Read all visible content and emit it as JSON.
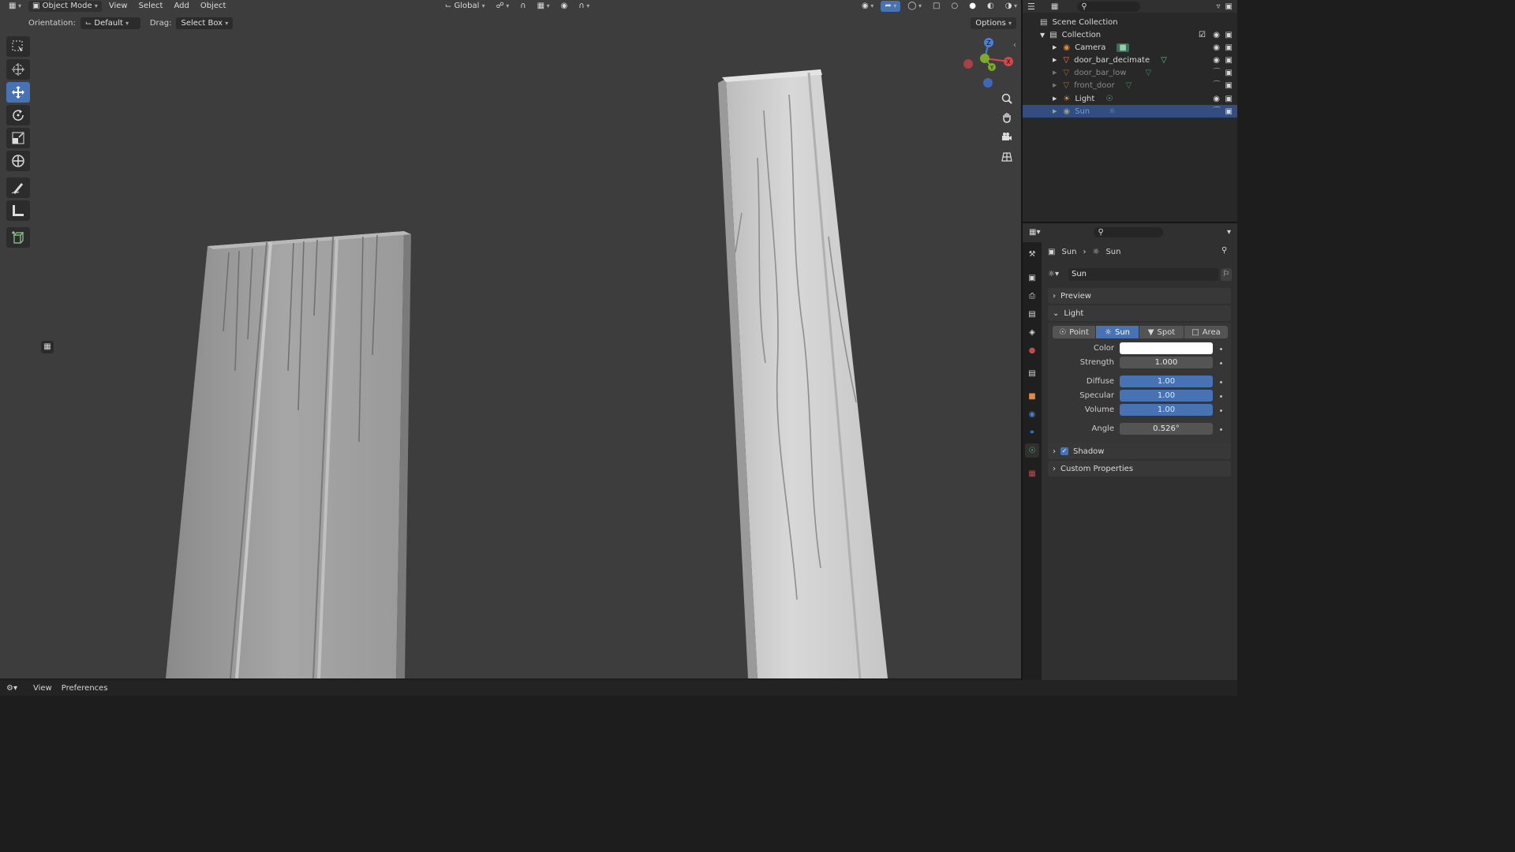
{
  "viewport_header": {
    "mode": "Object Mode",
    "menus": [
      "View",
      "Select",
      "Add",
      "Object"
    ],
    "transform_space": "Global"
  },
  "viewport_sub": {
    "orientation_label": "Orientation:",
    "orientation_value": "Default",
    "drag_label": "Drag:",
    "drag_value": "Select Box",
    "options": "Options"
  },
  "gizmo": {
    "z": "Z",
    "y": "Y",
    "x": "X"
  },
  "toolbar": [
    "select-box",
    "cursor",
    "move",
    "rotate",
    "scale",
    "transform",
    "annotate",
    "measure",
    "add-cube"
  ],
  "outliner": {
    "scene_collection": "Scene Collection",
    "collection": "Collection",
    "items": [
      {
        "name": "Camera",
        "style": "normal"
      },
      {
        "name": "door_bar_decimate",
        "style": "normal"
      },
      {
        "name": "door_bar_low",
        "style": "dim"
      },
      {
        "name": "front_door",
        "style": "dim"
      },
      {
        "name": "Light",
        "style": "normal"
      },
      {
        "name": "Sun",
        "style": "selected"
      }
    ]
  },
  "properties": {
    "breadcrumb_object": "Sun",
    "breadcrumb_data": "Sun",
    "datablock_name": "Sun",
    "panels": {
      "preview": "Preview",
      "light": "Light",
      "shadow": "Shadow",
      "custom": "Custom Properties"
    },
    "light_types": [
      "Point",
      "Sun",
      "Spot",
      "Area"
    ],
    "active_type": "Sun",
    "fields": {
      "color_label": "Color",
      "color_value": "#ffffff",
      "strength_label": "Strength",
      "strength": "1.000",
      "diffuse_label": "Diffuse",
      "diffuse": "1.00",
      "specular_label": "Specular",
      "specular": "1.00",
      "volume_label": "Volume",
      "volume": "1.00",
      "angle_label": "Angle",
      "angle": "0.526°"
    },
    "shadow_enabled": true
  },
  "statusbar": {
    "view": "View",
    "preferences": "Preferences"
  },
  "colors": {
    "accent": "#4772b3",
    "selected_row": "#334d80",
    "viewport_bg": "#3d3d3d"
  }
}
